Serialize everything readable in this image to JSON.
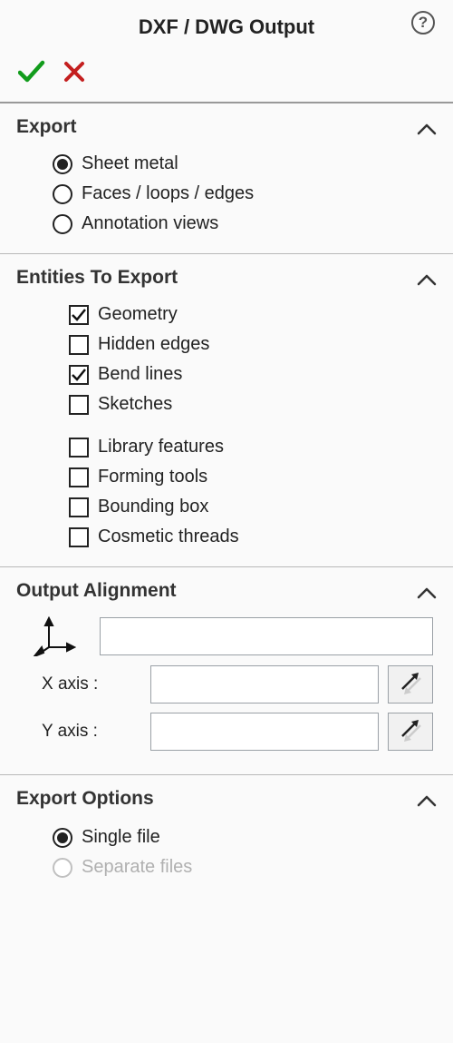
{
  "title": "DXF / DWG Output",
  "sections": {
    "export": {
      "label": "Export",
      "options": [
        {
          "label": "Sheet metal",
          "checked": true
        },
        {
          "label": "Faces / loops / edges",
          "checked": false
        },
        {
          "label": "Annotation views",
          "checked": false
        }
      ]
    },
    "entities": {
      "label": "Entities To Export",
      "items": [
        {
          "label": "Geometry",
          "checked": true
        },
        {
          "label": "Hidden edges",
          "checked": false
        },
        {
          "label": "Bend lines",
          "checked": true
        },
        {
          "label": "Sketches",
          "checked": false
        },
        {
          "label": "Library features",
          "checked": false
        },
        {
          "label": "Forming tools",
          "checked": false
        },
        {
          "label": "Bounding box",
          "checked": false
        },
        {
          "label": "Cosmetic threads",
          "checked": false
        }
      ]
    },
    "alignment": {
      "label": "Output Alignment",
      "x_label": "X axis :",
      "y_label": "Y axis :",
      "coord_system": "",
      "x_value": "",
      "y_value": ""
    },
    "export_options": {
      "label": "Export Options",
      "options": [
        {
          "label": "Single file",
          "checked": true,
          "disabled": false
        },
        {
          "label": "Separate files",
          "checked": false,
          "disabled": true
        }
      ]
    }
  }
}
